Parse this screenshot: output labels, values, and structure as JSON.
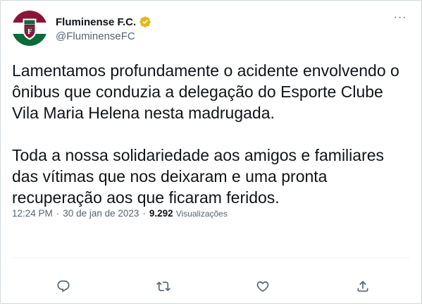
{
  "author": {
    "display_name": "Fluminense F.C.",
    "handle": "@FluminenseFC",
    "avatar_icon": "fluminense-crest-icon",
    "verified_icon": "verified-badge-icon",
    "brand_colors": {
      "maroon": "#8a1538",
      "green": "#0b6b3a",
      "white": "#ffffff"
    }
  },
  "more_icon": "more-options-icon",
  "more_label": "···",
  "tweet": {
    "paragraph_1": "Lamentamos profundamente o acidente envolvendo o ônibus que conduzia a delegação do Esporte Clube Vila Maria Helena nesta madrugada.",
    "paragraph_2": "Toda a nossa solidariedade aos amigos e familiares das vítimas que nos deixaram e uma pronta recuperação aos que ficaram feridos."
  },
  "meta": {
    "time": "12:24 PM",
    "separator": "·",
    "date": "30 de jan de 2023",
    "views_count": "9.292",
    "views_label": "Visualizações"
  },
  "actions": [
    {
      "icon": "reply-icon"
    },
    {
      "icon": "retweet-icon"
    },
    {
      "icon": "like-icon"
    },
    {
      "icon": "share-icon"
    }
  ],
  "colors": {
    "text": "#0f1419",
    "secondary": "#536471",
    "border": "#cfd9de",
    "verified": "#e2b719"
  }
}
